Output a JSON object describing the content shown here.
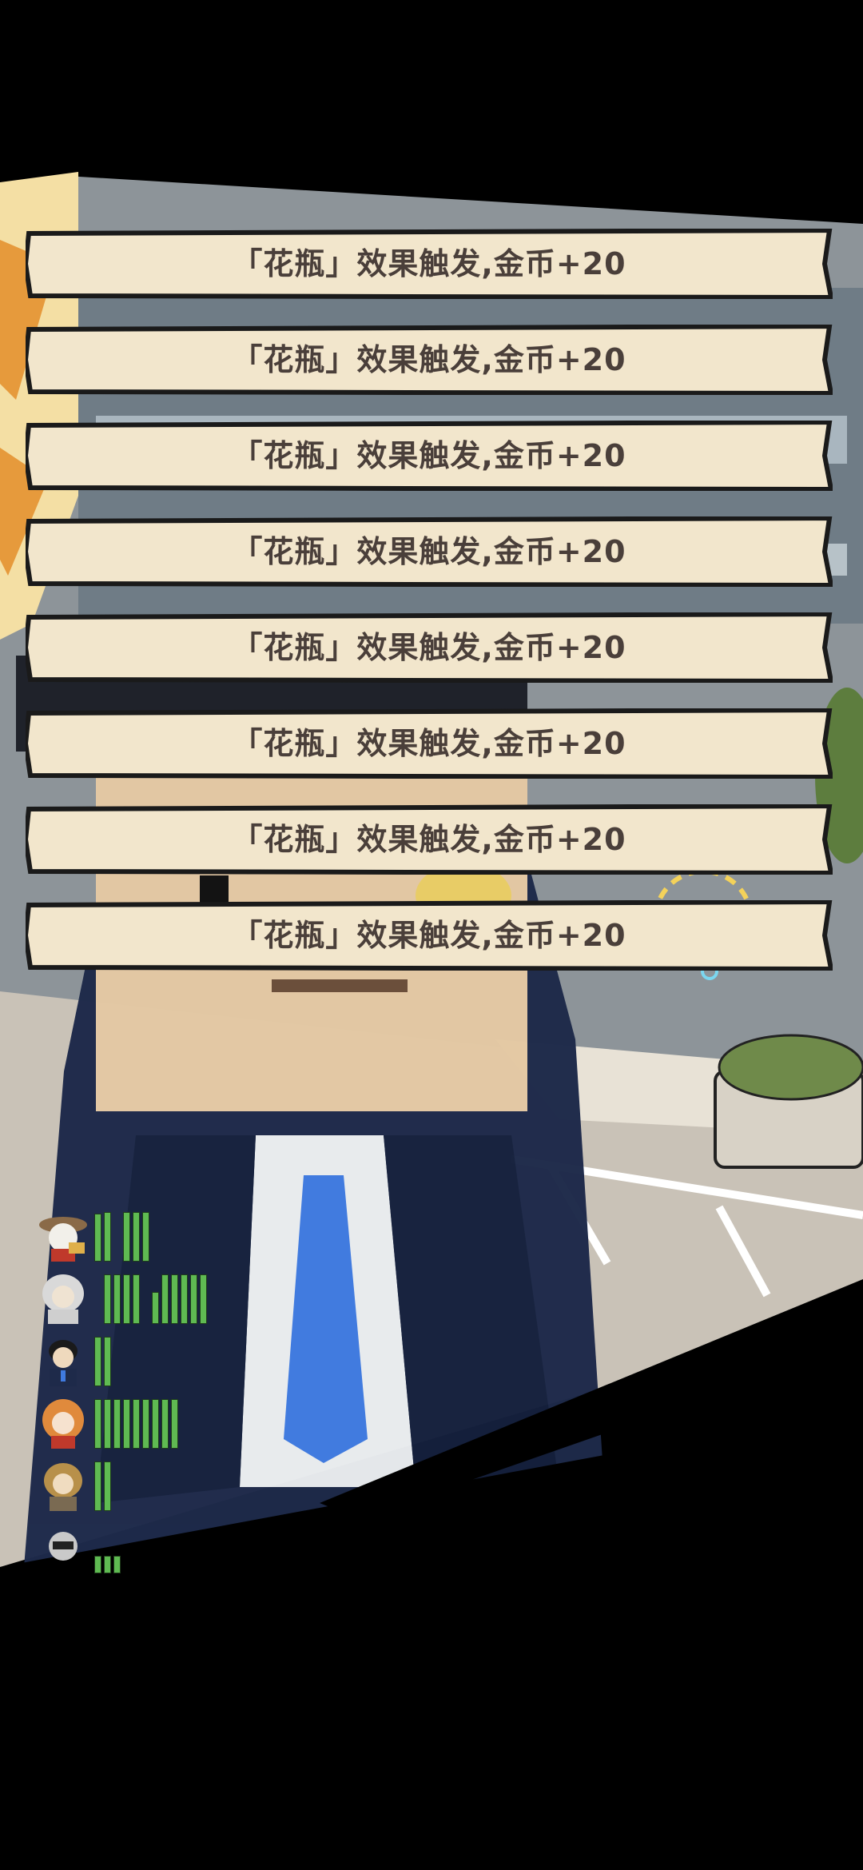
{
  "status": {
    "number": "20"
  },
  "notifications": [
    {
      "text": "「花瓶」效果触发,金币+20"
    },
    {
      "text": "「花瓶」效果触发,金币+20"
    },
    {
      "text": "「花瓶」效果触发,金币+20"
    },
    {
      "text": "「花瓶」效果触发,金币+20"
    },
    {
      "text": "「花瓶」效果触发,金币+20"
    },
    {
      "text": "「花瓶」效果触发,金币+20"
    },
    {
      "text": "「花瓶」效果触发,金币+20"
    },
    {
      "text": "「花瓶」效果触发,金币+20"
    }
  ],
  "party": [
    {
      "portrait": "cowboy-hat-character-icon"
    },
    {
      "portrait": "white-haired-elder-icon"
    },
    {
      "portrait": "dark-haired-boy-icon"
    },
    {
      "portrait": "orange-haired-girl-icon"
    },
    {
      "portrait": "blonde-warrior-icon"
    },
    {
      "portrait": "masked-character-icon"
    }
  ],
  "colors": {
    "banner": "#f2e6cc",
    "banner_border": "#1a1a1a",
    "text": "#4a3f3a",
    "bar_green": "#5fba52"
  }
}
